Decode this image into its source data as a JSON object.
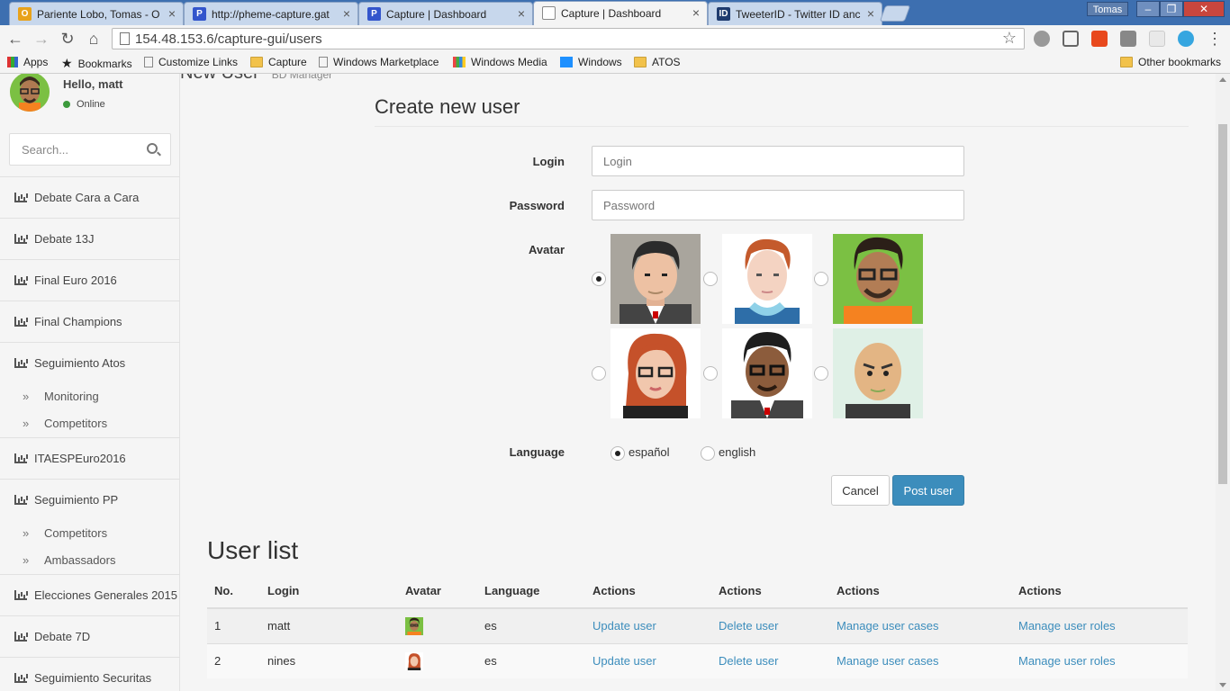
{
  "browser": {
    "tabs": [
      {
        "label": "Pariente Lobo, Tomas - O",
        "icon": "outlook-icon",
        "color": "#e8a21a"
      },
      {
        "label": "http://pheme-capture.gat",
        "icon": "capture-icon",
        "color": "#3355cc"
      },
      {
        "label": "Capture | Dashboard",
        "icon": "capture-icon",
        "color": "#3355cc"
      },
      {
        "label": "Capture | Dashboard",
        "icon": "page-icon",
        "color": "#ffffff"
      },
      {
        "label": "TweeterID - Twitter ID anc",
        "icon": "tweeterid-icon",
        "color": "#1f3b6e"
      }
    ],
    "window_user": "Tomas",
    "url": "154.48.153.6/capture-gui/users",
    "bookmarks": [
      "Apps",
      "Bookmarks",
      "Customize Links",
      "Capture",
      "Windows Marketplace",
      "Windows Media",
      "Windows",
      "ATOS"
    ],
    "other_bookmarks": "Other bookmarks"
  },
  "sidebar": {
    "greeting": "Hello, matt",
    "status": "Online",
    "search_placeholder": "Search...",
    "items": [
      {
        "label": "Debate Cara a Cara"
      },
      {
        "label": "Debate 13J"
      },
      {
        "label": "Final Euro 2016"
      },
      {
        "label": "Final Champions"
      },
      {
        "label": "Seguimiento Atos",
        "children": [
          "Monitoring",
          "Competitors"
        ]
      },
      {
        "label": "ITAESPEuro2016"
      },
      {
        "label": "Seguimiento PP",
        "children": [
          "Competitors",
          "Ambassadors"
        ]
      },
      {
        "label": "Elecciones Generales 2015"
      },
      {
        "label": "Debate 7D"
      },
      {
        "label": "Seguimiento Securitas"
      }
    ]
  },
  "header": {
    "title": "New User",
    "subtitle": "BD Manager"
  },
  "form": {
    "title": "Create new user",
    "login_label": "Login",
    "login_placeholder": "Login",
    "password_label": "Password",
    "password_placeholder": "Password",
    "avatar_label": "Avatar",
    "avatars": [
      "man-suit-avatar",
      "redhead-man-avatar",
      "glasses-beard-avatar",
      "redhead-woman-avatar",
      "dark-man-glasses-avatar",
      "bald-man-avatar"
    ],
    "selected_avatar": 0,
    "language_label": "Language",
    "languages": [
      "español",
      "english"
    ],
    "selected_language": 0,
    "cancel_label": "Cancel",
    "submit_label": "Post user"
  },
  "userlist": {
    "title": "User list",
    "columns": [
      "No.",
      "Login",
      "Avatar",
      "Language",
      "Actions",
      "Actions",
      "Actions",
      "Actions"
    ],
    "rows": [
      {
        "no": "1",
        "login": "matt",
        "avatar": "glasses-beard-avatar",
        "lang": "es",
        "a1": "Update user",
        "a2": "Delete user",
        "a3": "Manage user cases",
        "a4": "Manage user roles"
      },
      {
        "no": "2",
        "login": "nines",
        "avatar": "redhead-woman-avatar",
        "lang": "es",
        "a1": "Update user",
        "a2": "Delete user",
        "a3": "Manage user cases",
        "a4": "Manage user roles"
      }
    ]
  },
  "colors": {
    "primary": "#3c8dbc",
    "chrome": "#3d6fb0",
    "online": "#3c9a3c"
  }
}
